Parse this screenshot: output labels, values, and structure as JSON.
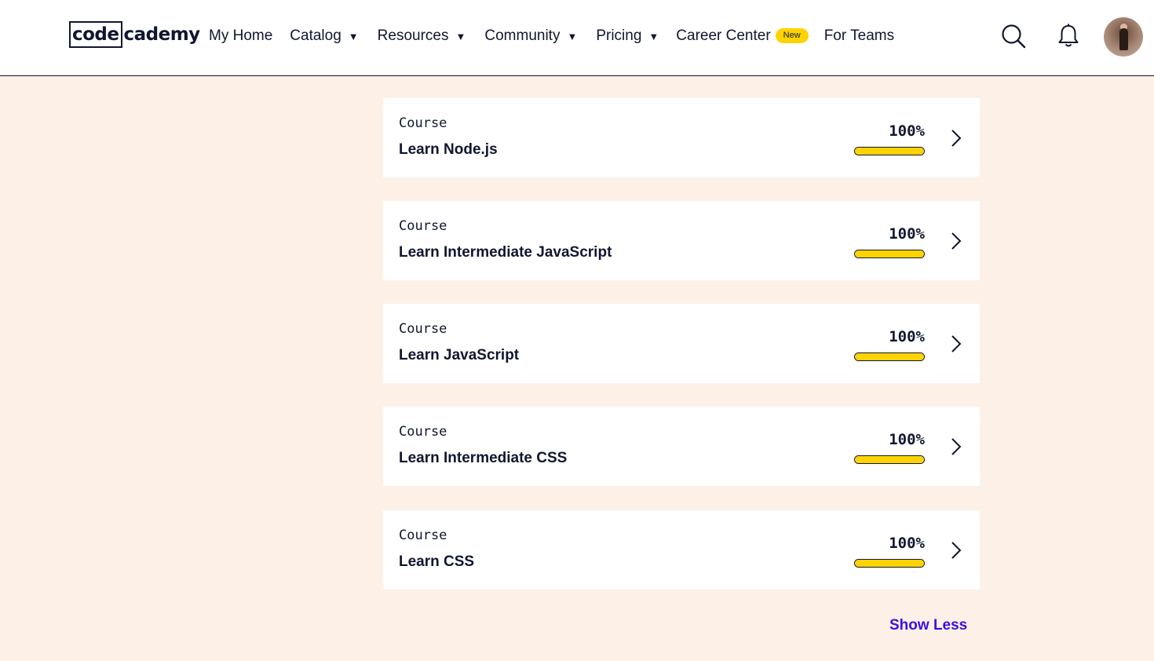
{
  "header": {
    "logo": {
      "box_text": "code",
      "rest_text": "cademy"
    },
    "nav": [
      {
        "label": "My Home",
        "dropdown": false
      },
      {
        "label": "Catalog",
        "dropdown": true
      },
      {
        "label": "Resources",
        "dropdown": true
      },
      {
        "label": "Community",
        "dropdown": true
      },
      {
        "label": "Pricing",
        "dropdown": true
      },
      {
        "label": "Career Center",
        "dropdown": false,
        "badge": "New"
      },
      {
        "label": "For Teams",
        "dropdown": false
      }
    ],
    "icons": {
      "search": "search-icon",
      "notifications": "bell-icon"
    },
    "caret": "▼"
  },
  "courses": [
    {
      "kind": "Course",
      "title": "Learn Node.js",
      "progress": "100%",
      "progress_value": 1.0
    },
    {
      "kind": "Course",
      "title": "Learn Intermediate JavaScript",
      "progress": "100%",
      "progress_value": 1.0
    },
    {
      "kind": "Course",
      "title": "Learn JavaScript",
      "progress": "100%",
      "progress_value": 1.0
    },
    {
      "kind": "Course",
      "title": "Learn Intermediate CSS",
      "progress": "100%",
      "progress_value": 1.0
    },
    {
      "kind": "Course",
      "title": "Learn CSS",
      "progress": "100%",
      "progress_value": 1.0
    }
  ],
  "show_less_label": "Show Less",
  "colors": {
    "page_bg": "#fdf0e7",
    "ink": "#10162f",
    "progress_fill": "#ffd300",
    "badge": "#ffd300",
    "link": "#3a10e5"
  }
}
